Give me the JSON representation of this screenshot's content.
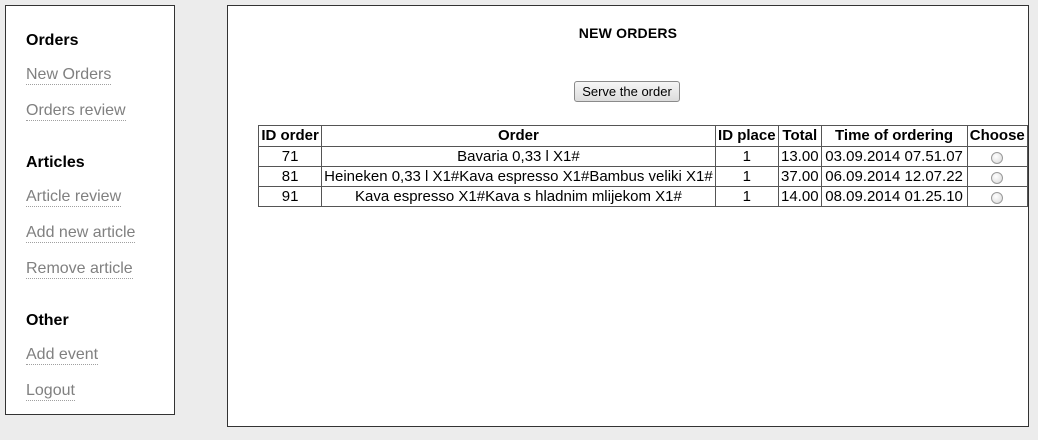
{
  "sidebar": {
    "sections": [
      {
        "title": "Orders",
        "links": [
          "New Orders",
          "Orders review"
        ]
      },
      {
        "title": "Articles",
        "links": [
          "Article review",
          "Add new article",
          "Remove article"
        ]
      },
      {
        "title": "Other",
        "links": [
          "Add event",
          "Logout"
        ]
      }
    ]
  },
  "main": {
    "title": "NEW ORDERS",
    "serve_button": "Serve the order",
    "table": {
      "headers": [
        "ID order",
        "Order",
        "ID place",
        "Total",
        "Time of ordering",
        "Choose"
      ],
      "rows": [
        {
          "id_order": "71",
          "order": "Bavaria 0,33 l X1#",
          "id_place": "1",
          "total": "13.00",
          "time": "03.09.2014 07.51.07"
        },
        {
          "id_order": "81",
          "order": "Heineken 0,33 l X1#Kava espresso X1#Bambus veliki X1#",
          "id_place": "1",
          "total": "37.00",
          "time": "06.09.2014 12.07.22"
        },
        {
          "id_order": "91",
          "order": "Kava espresso X1#Kava s hladnim mlijekom X1#",
          "id_place": "1",
          "total": "14.00",
          "time": "08.09.2014 01.25.10"
        }
      ]
    }
  }
}
